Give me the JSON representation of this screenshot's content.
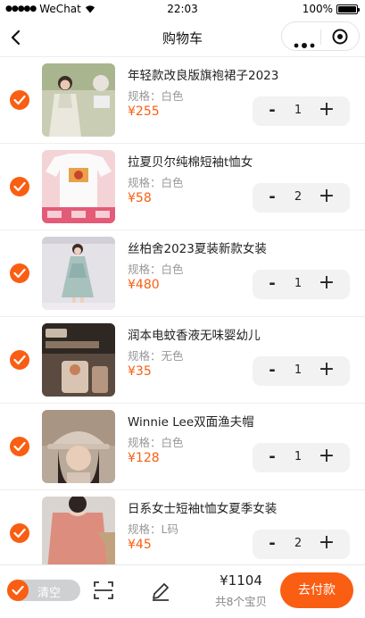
{
  "status_bar": {
    "carrier": "WeChat",
    "time": "22:03",
    "battery": "100%"
  },
  "nav": {
    "title": "购物车"
  },
  "items": [
    {
      "title": "年轻款改良版旗袍裙子2023",
      "spec": "规格：白色",
      "price": "¥255",
      "qty": "1",
      "minus": "-",
      "plus": "+"
    },
    {
      "title": "拉夏贝尔纯棉短袖t恤女",
      "spec": "规格：白色",
      "price": "¥58",
      "qty": "2",
      "minus": "-",
      "plus": "+"
    },
    {
      "title": "丝柏舍2023夏装新款女装",
      "spec": "规格：白色",
      "price": "¥480",
      "qty": "1",
      "minus": "-",
      "plus": "+"
    },
    {
      "title": "润本电蚊香液无味婴幼儿",
      "spec": "规格：无色",
      "price": "¥35",
      "qty": "1",
      "minus": "-",
      "plus": "+"
    },
    {
      "title": "Winnie Lee双面渔夫帽",
      "spec": "规格：白色",
      "price": "¥128",
      "qty": "1",
      "minus": "-",
      "plus": "+"
    },
    {
      "title": "日系女士短袖t恤女夏季女装",
      "spec": "规格：L码",
      "price": "¥45",
      "qty": "2",
      "minus": "-",
      "plus": "+"
    }
  ],
  "bottom": {
    "clear_label": "清空",
    "total_amount": "¥1104",
    "total_count": "共8个宝贝",
    "pay_label": "去付款"
  },
  "colors": {
    "accent": "#f95e12",
    "stepper_bg": "#f2f2f2",
    "toggle_bg": "#cfd0d2"
  },
  "icons": {
    "back": "chevron-left-icon",
    "more": "more-dots-icon",
    "close": "target-close-icon",
    "check": "check-icon",
    "scan": "scan-icon",
    "edit": "pencil-icon"
  }
}
